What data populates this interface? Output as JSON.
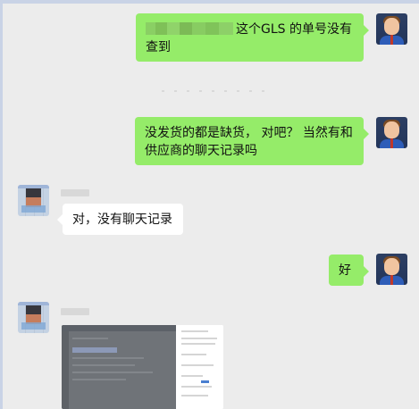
{
  "messages": [
    {
      "direction": "sent",
      "redacted_prefix": true,
      "text": "这个GLS 的单号没有查到"
    },
    {
      "direction": "sent",
      "text": "没发货的都是缺货， 对吧？ 当然有和供应商的聊天记录吗"
    },
    {
      "direction": "received",
      "text": "对，没有聊天记录"
    },
    {
      "direction": "sent",
      "text": "好"
    },
    {
      "direction": "received",
      "type": "image",
      "content": "screenshot-thumbnail"
    }
  ],
  "colors": {
    "background": "#ececec",
    "sent_bubble": "#95ec69",
    "received_bubble": "#ffffff"
  }
}
